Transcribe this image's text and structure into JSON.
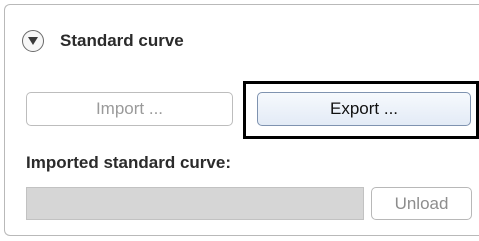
{
  "panel": {
    "title": "Standard curve",
    "collapse_icon": "chevron-down-circle-icon"
  },
  "buttons": {
    "import_label": "Import ...",
    "export_label": "Export ...",
    "unload_label": "Unload"
  },
  "imported": {
    "label": "Imported standard curve:",
    "value": ""
  },
  "colors": {
    "focus_outline": "#000000",
    "disabled_text": "#9a9a9a",
    "field_background": "#d6d6d6"
  }
}
